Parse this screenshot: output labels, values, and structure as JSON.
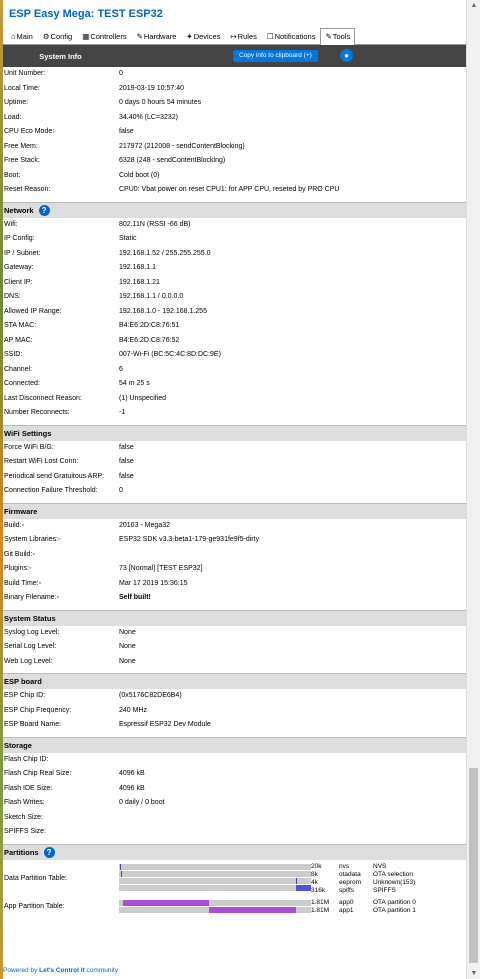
{
  "title": "ESP Easy Mega: TEST ESP32",
  "tabs": [
    {
      "icon": "⌂",
      "label": "Main"
    },
    {
      "icon": "⚙",
      "label": "Config"
    },
    {
      "icon": "▦",
      "label": "Controllers"
    },
    {
      "icon": "✎",
      "label": "Hardware"
    },
    {
      "icon": "✦",
      "label": "Devices"
    },
    {
      "icon": "↦",
      "label": "Rules"
    },
    {
      "icon": "☐",
      "label": "Notifications"
    },
    {
      "icon": "✎",
      "label": "Tools"
    }
  ],
  "header": {
    "title": "System Info",
    "copy_label": "Copy info to clipboard (+)"
  },
  "system": [
    {
      "k": "Unit Number:",
      "v": "0"
    },
    {
      "k": "Local Time:",
      "v": "2019-03-19 10:57:40"
    },
    {
      "k": "Uptime:",
      "v": "0 days 0 hours 54 minutes"
    },
    {
      "k": "Load:",
      "v": "34.40% (LC=3232)"
    },
    {
      "k": "CPU Eco Mode:",
      "v": "false"
    },
    {
      "k": "Free Mem:",
      "v": "217972 (212008 - sendContentBlocking)"
    },
    {
      "k": "Free Stack:",
      "v": "6328 (248 - sendContentBlocking)"
    },
    {
      "k": "Boot:",
      "v": "Cold boot (0)"
    },
    {
      "k": "Reset Reason:",
      "v": "CPU0: Vbat power on reset CPU1: for APP CPU, reseted by PRO CPU"
    }
  ],
  "network_title": "Network",
  "network": [
    {
      "k": "Wifi:",
      "v": "802.11N (RSSI -66 dB)"
    },
    {
      "k": "IP Config:",
      "v": "Static"
    },
    {
      "k": "IP / Subnet:",
      "v": "192.168.1.52 / 255.255.255.0"
    },
    {
      "k": "Gateway:",
      "v": "192.168.1.1"
    },
    {
      "k": "Client IP:",
      "v": "192.168.1.21"
    },
    {
      "k": "DNS:",
      "v": "192.168.1.1 / 0.0.0.0"
    },
    {
      "k": "Allowed IP Range:",
      "v": "192.168.1.0 - 192.168.1.255"
    },
    {
      "k": "STA MAC:",
      "v": "B4:E6:2D:C8:76:51"
    },
    {
      "k": "AP MAC:",
      "v": "B4:E6:2D:C8:76:52"
    },
    {
      "k": "SSID:",
      "v": "007-Wi-Fi (BC:5C:4C:8D:DC:9E)"
    },
    {
      "k": "Channel:",
      "v": "6"
    },
    {
      "k": "Connected:",
      "v": "54 m 25 s"
    },
    {
      "k": "Last Disconnect Reason:",
      "v": "(1) Unspecified"
    },
    {
      "k": "Number Reconnects:",
      "v": "-1"
    }
  ],
  "wifi_title": "WiFi Settings",
  "wifi": [
    {
      "k": "Force WiFi B/G:",
      "v": "false"
    },
    {
      "k": "Restart WiFi Lost Conn:",
      "v": "false"
    },
    {
      "k": "Periodical send Gratuitous ARP:",
      "v": "false"
    },
    {
      "k": "Connection Failure Threshold:",
      "v": "0"
    }
  ],
  "firmware_title": "Firmware",
  "firmware": [
    {
      "k": "Build:◦",
      "v": "20103 - Mega32"
    },
    {
      "k": "System Libraries:◦",
      "v": "ESP32 SDK v3.3-beta1-179-ge931fe9f5-dirty"
    },
    {
      "k": "Git Build:◦",
      "v": ""
    },
    {
      "k": "Plugins:◦",
      "v": "73 [Normal] [TEST ESP32]"
    },
    {
      "k": "Build Time:◦",
      "v": "Mar 17 2019 15:36:15"
    },
    {
      "k": "Binary Filename:◦",
      "v": "Self built!",
      "bold": true
    }
  ],
  "status_title": "System Status",
  "status": [
    {
      "k": "Syslog Log Level:",
      "v": "None"
    },
    {
      "k": "Serial Log Level:",
      "v": "None"
    },
    {
      "k": "Web Log Level:",
      "v": "None"
    }
  ],
  "esp_title": "ESP board",
  "esp": [
    {
      "k": "ESP Chip ID:",
      "v": "(0x5176C82DE6B4)"
    },
    {
      "k": "ESP Chip Frequency:",
      "v": "240 MHz"
    },
    {
      "k": "ESP Board Name:",
      "v": "Espressif ESP32 Dev Module"
    }
  ],
  "storage_title": "Storage",
  "storage": [
    {
      "k": "Flash Chip ID:",
      "v": ""
    },
    {
      "k": "Flash Chip Real Size:",
      "v": "4096 kB"
    },
    {
      "k": "Flash IDE Size:",
      "v": "4096 kB"
    },
    {
      "k": "Flash Writes:",
      "v": "0 daily / 0 boot"
    },
    {
      "k": "Sketch Size:",
      "v": ""
    },
    {
      "k": "SPIFFS Size:",
      "v": ""
    }
  ],
  "partitions_title": "Partitions",
  "data_partition_label": "Data Partition Table:",
  "data_partitions": [
    {
      "size": "20k",
      "name": "nvs",
      "type": "NVS",
      "start": 0.005,
      "len": 0.005,
      "color": "#3c3cc8"
    },
    {
      "size": "8k",
      "name": "otadata",
      "type": "OTA selection",
      "start": 0.01,
      "len": 0.003,
      "color": "#3c3cc8"
    },
    {
      "size": "4k",
      "name": "eeprom",
      "type": "Unknown(153)",
      "start": 0.92,
      "len": 0.003,
      "color": "#3c3cc8"
    },
    {
      "size": "316k",
      "name": "spiffs",
      "type": "SPIFFS",
      "start": 0.923,
      "len": 0.077,
      "color": "#5050d8"
    }
  ],
  "app_partition_label": "App Partition Table:",
  "app_partitions": [
    {
      "size": "1.81M",
      "name": "app0",
      "type": "OTA partition 0",
      "start": 0.02,
      "len": 0.45,
      "color": "#b04ad8"
    },
    {
      "size": "1.81M",
      "name": "app1",
      "type": "OTA partition 1",
      "start": 0.47,
      "len": 0.45,
      "color": "#b04ad8"
    }
  ],
  "footer": {
    "prefix": "Powered by ",
    "brand": "Let's Control It",
    "suffix": " community"
  }
}
